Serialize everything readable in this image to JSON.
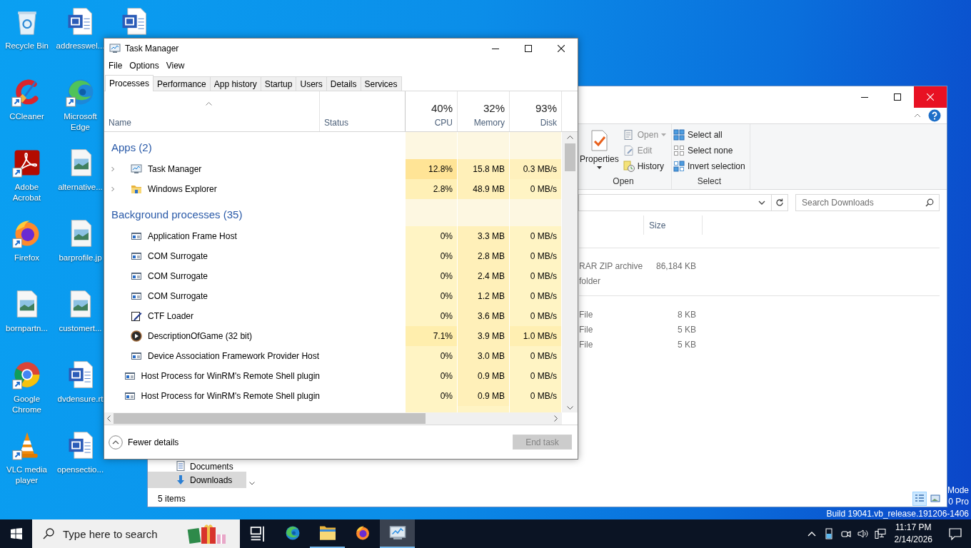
{
  "desktop": {
    "columns": [
      [
        {
          "label": "Recycle Bin",
          "kind": "recycle",
          "shortcut": false
        },
        {
          "label": "CCleaner",
          "kind": "ccleaner",
          "shortcut": true
        },
        {
          "label": "Adobe Acrobat",
          "kind": "acrobat",
          "shortcut": true
        },
        {
          "label": "Firefox",
          "kind": "firefox",
          "shortcut": true
        },
        {
          "label": "bornpartn...",
          "kind": "image",
          "shortcut": false
        },
        {
          "label": "Google Chrome",
          "kind": "chrome",
          "shortcut": true
        },
        {
          "label": "VLC media player",
          "kind": "vlc",
          "shortcut": true
        }
      ],
      [
        {
          "label": "addresswel...",
          "kind": "word",
          "shortcut": false
        },
        {
          "label": "Microsoft Edge",
          "kind": "edge",
          "shortcut": true
        },
        {
          "label": "alternative...",
          "kind": "image",
          "shortcut": false
        },
        {
          "label": "barprofile.jp",
          "kind": "image",
          "shortcut": false
        },
        {
          "label": "customert...",
          "kind": "image",
          "shortcut": false
        },
        {
          "label": "dvdensure.rt",
          "kind": "word",
          "shortcut": false
        },
        {
          "label": "opensectio...",
          "kind": "word",
          "shortcut": false
        }
      ],
      [
        {
          "kind": "word",
          "shortcut": false
        }
      ]
    ],
    "corner_text": [
      "Mode",
      "0 Pro",
      "Build 19041.vb_release.191206-1406"
    ]
  },
  "explorer": {
    "ribbon": {
      "groups": [
        {
          "label": "Open",
          "items": [
            {
              "label": "Properties",
              "kind": "properties",
              "disabled": false,
              "dropdown": true
            },
            {
              "label": "Open",
              "kind": "open",
              "disabled": true,
              "dropdown": true
            },
            {
              "label": "Edit",
              "kind": "edit",
              "disabled": true,
              "dropdown": false
            },
            {
              "label": "History",
              "kind": "history",
              "disabled": false,
              "dropdown": false
            }
          ]
        },
        {
          "label": "Select",
          "items": [
            {
              "label": "Select all",
              "kind": "select-all",
              "disabled": false,
              "dropdown": false
            },
            {
              "label": "Select none",
              "kind": "select-none",
              "disabled": false,
              "dropdown": false
            },
            {
              "label": "Invert selection",
              "kind": "invert",
              "disabled": false,
              "dropdown": false
            }
          ]
        }
      ]
    },
    "search": {
      "placeholder": "Search Downloads"
    },
    "columns": [
      {
        "label": "Size"
      }
    ],
    "groups": [
      {
        "rows": [
          {
            "type": "RAR ZIP archive",
            "size": "86,184 KB"
          },
          {
            "type": "folder"
          }
        ]
      },
      {
        "rows": [
          {
            "type": "File",
            "size": "8 KB"
          },
          {
            "type": "File",
            "size": "5 KB"
          },
          {
            "type": "File",
            "size": "5 KB"
          }
        ]
      }
    ],
    "nav": [
      {
        "label": "Documents",
        "kind": "documents",
        "selected": false
      },
      {
        "label": "Downloads",
        "kind": "downloads",
        "selected": true
      }
    ],
    "status": "5 items",
    "views": [
      {
        "kind": "details",
        "selected": true
      },
      {
        "kind": "large-icons",
        "selected": false
      }
    ]
  },
  "taskmgr": {
    "title": "Task Manager",
    "menu": [
      "File",
      "Options",
      "View"
    ],
    "tabs": [
      {
        "label": "Processes",
        "selected": true
      },
      {
        "label": "Performance",
        "selected": false
      },
      {
        "label": "App history",
        "selected": false
      },
      {
        "label": "Startup",
        "selected": false
      },
      {
        "label": "Users",
        "selected": false
      },
      {
        "label": "Details",
        "selected": false
      },
      {
        "label": "Services",
        "selected": false
      }
    ],
    "columns": [
      {
        "label": "Name",
        "kind": "name",
        "sorted": true
      },
      {
        "label": "Status",
        "kind": "status",
        "sorted": false
      },
      {
        "label": "CPU",
        "total": "40%",
        "kind": "metric",
        "sorted": false
      },
      {
        "label": "Memory",
        "total": "32%",
        "kind": "metric",
        "sorted": false
      },
      {
        "label": "Disk",
        "total": "93%",
        "kind": "metric",
        "sorted": false
      }
    ],
    "groups": [
      {
        "title": "Apps (2)",
        "rows": [
          {
            "kind": "monitor",
            "name": "Task Manager",
            "expanded": false,
            "cpu": {
              "text": "12.8%",
              "color": "#ffe496"
            },
            "memory": {
              "text": "15.8 MB",
              "color": "#fff0b9"
            },
            "disk": {
              "text": "0.3 MB/s",
              "color": "#fff1bd"
            }
          },
          {
            "kind": "folder",
            "name": "Windows Explorer",
            "expanded": false,
            "cpu": {
              "text": "2.8%",
              "color": "#fff0b6"
            },
            "memory": {
              "text": "48.9 MB",
              "color": "#fff0b9"
            },
            "disk": {
              "text": "0 MB/s",
              "color": "#fff4c4"
            }
          }
        ]
      },
      {
        "title": "Background processes (35)",
        "rows": [
          {
            "kind": "frame",
            "name": "Application Frame Host",
            "cpu": {
              "text": "0%",
              "color": "#fff4c4"
            },
            "memory": {
              "text": "3.3 MB",
              "color": "#fff0b9"
            },
            "disk": {
              "text": "0 MB/s",
              "color": "#fff4c4"
            }
          },
          {
            "kind": "frame",
            "name": "COM Surrogate",
            "cpu": {
              "text": "0%",
              "color": "#fff4c4"
            },
            "memory": {
              "text": "2.8 MB",
              "color": "#fff0b9"
            },
            "disk": {
              "text": "0 MB/s",
              "color": "#fff4c4"
            }
          },
          {
            "kind": "frame",
            "name": "COM Surrogate",
            "cpu": {
              "text": "0%",
              "color": "#fff4c4"
            },
            "memory": {
              "text": "2.4 MB",
              "color": "#fff0b9"
            },
            "disk": {
              "text": "0 MB/s",
              "color": "#fff4c4"
            }
          },
          {
            "kind": "frame",
            "name": "COM Surrogate",
            "cpu": {
              "text": "0%",
              "color": "#fff4c4"
            },
            "memory": {
              "text": "1.2 MB",
              "color": "#fff0b9"
            },
            "disk": {
              "text": "0 MB/s",
              "color": "#fff4c4"
            }
          },
          {
            "kind": "pen",
            "name": "CTF Loader",
            "cpu": {
              "text": "0%",
              "color": "#fff4c4"
            },
            "memory": {
              "text": "3.6 MB",
              "color": "#fff0b9"
            },
            "disk": {
              "text": "0 MB/s",
              "color": "#fff4c4"
            }
          },
          {
            "kind": "play",
            "name": "DescriptionOfGame (32 bit)",
            "cpu": {
              "text": "7.1%",
              "color": "#ffeead"
            },
            "memory": {
              "text": "3.9 MB",
              "color": "#fff0b9"
            },
            "disk": {
              "text": "1.0 MB/s",
              "color": "#ffefb2"
            }
          },
          {
            "kind": "frame",
            "name": "Device Association Framework Provider Host",
            "cpu": {
              "text": "0%",
              "color": "#fff4c4"
            },
            "memory": {
              "text": "3.0 MB",
              "color": "#fff0b9"
            },
            "disk": {
              "text": "0 MB/s",
              "color": "#fff4c4"
            }
          },
          {
            "kind": "frame",
            "name": "Host Process for WinRM's Remote Shell plugin",
            "cpu": {
              "text": "0%",
              "color": "#fff4c4"
            },
            "memory": {
              "text": "0.9 MB",
              "color": "#fff0b9"
            },
            "disk": {
              "text": "0 MB/s",
              "color": "#fff4c4"
            }
          },
          {
            "kind": "frame",
            "name": "Host Process for WinRM's Remote Shell plugin",
            "cpu": {
              "text": "0%",
              "color": "#fff4c4"
            },
            "memory": {
              "text": "0.9 MB",
              "color": "#fff0b9"
            },
            "disk": {
              "text": "0 MB/s",
              "color": "#fff4c4"
            }
          }
        ]
      }
    ],
    "fewer_details": "Fewer details",
    "end_task": {
      "label": "End task",
      "disabled": true
    }
  },
  "taskbar": {
    "search": {
      "placeholder": "Type here to search"
    },
    "apps": [
      {
        "kind": "task-view",
        "running": false,
        "active": false
      },
      {
        "kind": "edge",
        "running": false,
        "active": false
      },
      {
        "kind": "explorer",
        "running": true,
        "active": false
      },
      {
        "kind": "firefox",
        "running": false,
        "active": false
      },
      {
        "kind": "task-manager",
        "running": true,
        "active": true
      }
    ],
    "time": "11:17 PM",
    "date": "2/14/2026"
  }
}
